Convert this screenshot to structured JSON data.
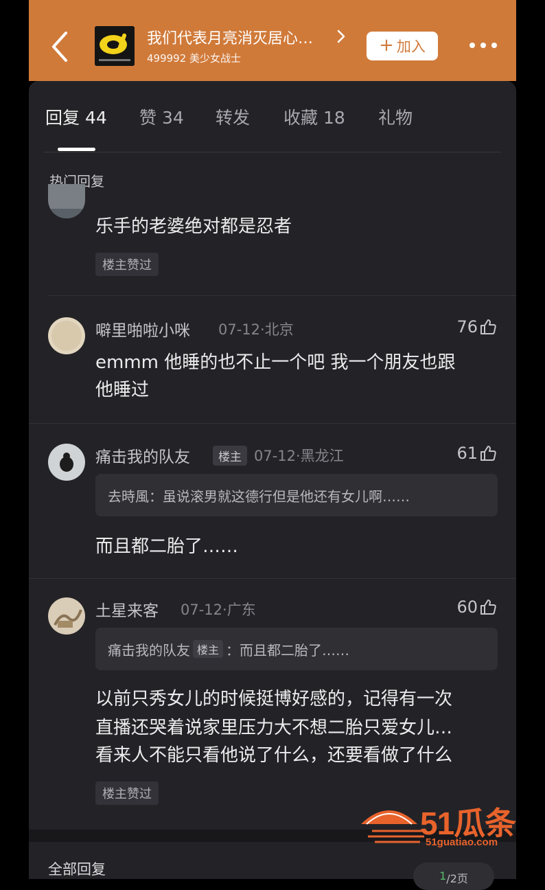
{
  "header": {
    "title": "我们代表月亮消灭居心…",
    "subtitle": "499992 美少女战士",
    "join_label": "加入",
    "colors": {
      "background": "#d07a3a",
      "text": "#ffffff"
    }
  },
  "tabs": [
    {
      "label": "回复 44",
      "active": true
    },
    {
      "label": "赞 34",
      "active": false
    },
    {
      "label": "转发",
      "active": false
    },
    {
      "label": "收藏 18",
      "active": false
    },
    {
      "label": "礼物",
      "active": false
    }
  ],
  "hot_section_label": "热门回复",
  "first_comment": {
    "content": "乐手的老婆绝对都是忍者",
    "badge": "楼主赞过"
  },
  "comments": [
    {
      "username": "噼里啪啦小咪",
      "meta": "07-12·北京",
      "likes": "76",
      "content": [
        "emmm 他睡的也不止一个吧 我一个朋友也跟",
        "他睡过"
      ]
    },
    {
      "username": "痛击我的队友",
      "op_badge": "楼主",
      "meta": "07-12·黑龙江",
      "likes": "61",
      "quote": {
        "text": "去時風：虽说滚男就这德行但是他还有女儿啊……"
      },
      "content": [
        "而且都二胎了……"
      ]
    },
    {
      "username": "土星来客",
      "meta": "07-12·广东",
      "likes": "60",
      "quote": {
        "author": "痛击我的队友",
        "badge": "楼主",
        "text": "：而且都二胎了……"
      },
      "content": [
        "以前只秀女儿的时候挺博好感的，记得有一次",
        "直播还哭着说家里压力大不想二胎只爱女儿…",
        "看来人不能只看他说了什么，还要看做了什么"
      ],
      "badge": "楼主赞过"
    }
  ],
  "bottom": {
    "all_replies_label": "全部回复",
    "pager": {
      "current": "1",
      "rest": "/2页"
    }
  },
  "watermark": {
    "brand": "51瓜条",
    "url": "51guatiao.com",
    "color": "#e8632c"
  },
  "icons": [
    "back-arrow-icon",
    "chevron-right-icon",
    "plus-icon",
    "more-dots-icon",
    "thumbs-up-icon",
    "watermelon-logo-icon"
  ]
}
